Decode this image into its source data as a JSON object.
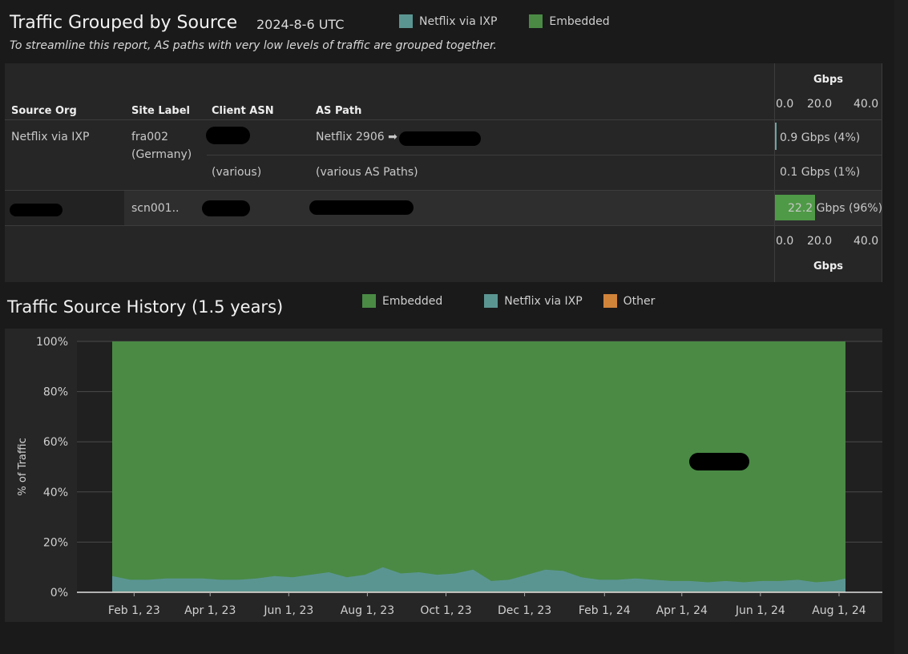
{
  "header": {
    "title": "Traffic Grouped by Source",
    "date": "2024-8-6 UTC",
    "subtitle": "To streamline this report, AS paths with very low levels of traffic are grouped together.",
    "legend": [
      {
        "label": "Netflix via IXP",
        "color": "#5b9592"
      },
      {
        "label": "Embedded",
        "color": "#4a8a45"
      }
    ]
  },
  "table": {
    "columns": [
      "Source Org",
      "Site Label",
      "Client ASN",
      "AS Path"
    ],
    "gbps_label_top": "Gbps",
    "gbps_label_bottom": "Gbps",
    "gbps_ticks": [
      "0.0",
      "20.0",
      "40.0"
    ],
    "rows": [
      {
        "source_org": "Netflix via IXP",
        "site_label": "fra002 (Germany)",
        "client_asn": "",
        "as_path": "Netflix 2906 ➡",
        "value_gbps": 0.9,
        "value_label": "0.9 Gbps (4%)"
      },
      {
        "source_org": "",
        "site_label": "",
        "client_asn": "(various)",
        "as_path": "(various AS Paths)",
        "value_gbps": 0.1,
        "value_label": "0.1 Gbps (1%)"
      },
      {
        "source_org": "",
        "site_label": "scn001..",
        "client_asn": "",
        "as_path": "",
        "value_gbps": 22.2,
        "value_label": "22.2 Gbps (96%)"
      }
    ],
    "bar_max": 40,
    "bar_color": "#4f9a47",
    "thin_bar_color": "#6fa3a0"
  },
  "history": {
    "title": "Traffic Source History (1.5 years)",
    "legend": [
      {
        "label": "Embedded",
        "color": "#4a8a45"
      },
      {
        "label": "Netflix via IXP",
        "color": "#5b9592"
      },
      {
        "label": "Other",
        "color": "#d0843a"
      }
    ]
  },
  "chart_data": {
    "type": "area",
    "ylabel": "% of Traffic",
    "ylim": [
      0,
      100
    ],
    "yticks": [
      "0%",
      "20%",
      "40%",
      "60%",
      "80%",
      "100%"
    ],
    "xticks": [
      "Feb 1, 23",
      "Apr 1, 23",
      "Jun 1, 23",
      "Aug 1, 23",
      "Oct 1, 23",
      "Dec 1, 23",
      "Feb 1, 24",
      "Apr 1, 24",
      "Jun 1, 24",
      "Aug 1, 24"
    ],
    "x_range": [
      "2023-01-15",
      "2024-08-06"
    ],
    "grid": true,
    "stacked": true,
    "series": [
      {
        "name": "Netflix via IXP",
        "color": "#5b9592",
        "x": [
          "2023-01-15",
          "2023-01-29",
          "2023-02-12",
          "2023-02-26",
          "2023-03-12",
          "2023-03-26",
          "2023-04-09",
          "2023-04-23",
          "2023-05-07",
          "2023-05-21",
          "2023-06-04",
          "2023-06-18",
          "2023-07-02",
          "2023-07-16",
          "2023-07-30",
          "2023-08-13",
          "2023-08-27",
          "2023-09-10",
          "2023-09-24",
          "2023-10-08",
          "2023-10-22",
          "2023-11-05",
          "2023-11-19",
          "2023-12-03",
          "2023-12-17",
          "2023-12-31",
          "2024-01-14",
          "2024-01-28",
          "2024-02-11",
          "2024-02-25",
          "2024-03-10",
          "2024-03-24",
          "2024-04-07",
          "2024-04-21",
          "2024-05-05",
          "2024-05-19",
          "2024-06-02",
          "2024-06-16",
          "2024-06-30",
          "2024-07-14",
          "2024-07-28",
          "2024-08-06"
        ],
        "values": [
          6.5,
          5.0,
          5.0,
          5.5,
          5.5,
          5.5,
          5.0,
          5.0,
          5.5,
          6.5,
          6.0,
          7.0,
          8.0,
          6.0,
          7.0,
          10.0,
          7.5,
          8.0,
          7.0,
          7.5,
          9.0,
          4.5,
          5.0,
          7.0,
          9.0,
          8.5,
          6.0,
          5.0,
          5.0,
          5.5,
          5.0,
          4.5,
          4.5,
          4.0,
          4.5,
          4.0,
          4.5,
          4.5,
          5.0,
          4.0,
          4.5,
          5.5
        ]
      },
      {
        "name": "Other",
        "color": "#d0843a",
        "x": [
          "2023-01-15",
          "2024-08-06"
        ],
        "values": [
          0.3,
          0.3
        ]
      },
      {
        "name": "Embedded",
        "color": "#4a8a45",
        "x": [
          "2023-01-15",
          "2024-08-06"
        ],
        "values": [
          "remainder",
          "remainder"
        ]
      }
    ]
  }
}
